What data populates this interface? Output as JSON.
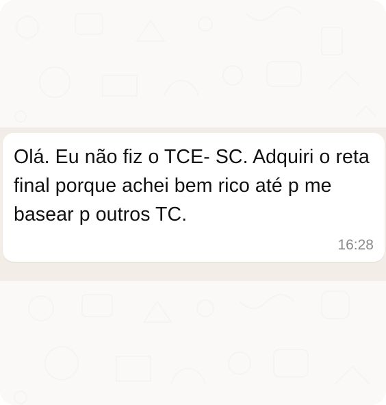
{
  "message": {
    "text": "Olá. Eu não fiz o TCE- SC. Adquiri o reta final porque achei bem rico até p me basear p outros TC.",
    "time": "16:28"
  },
  "colors": {
    "wallpaper": "#efeae6",
    "bubble": "#ffffff",
    "text": "#111111",
    "timestamp": "#8a8a8a"
  }
}
